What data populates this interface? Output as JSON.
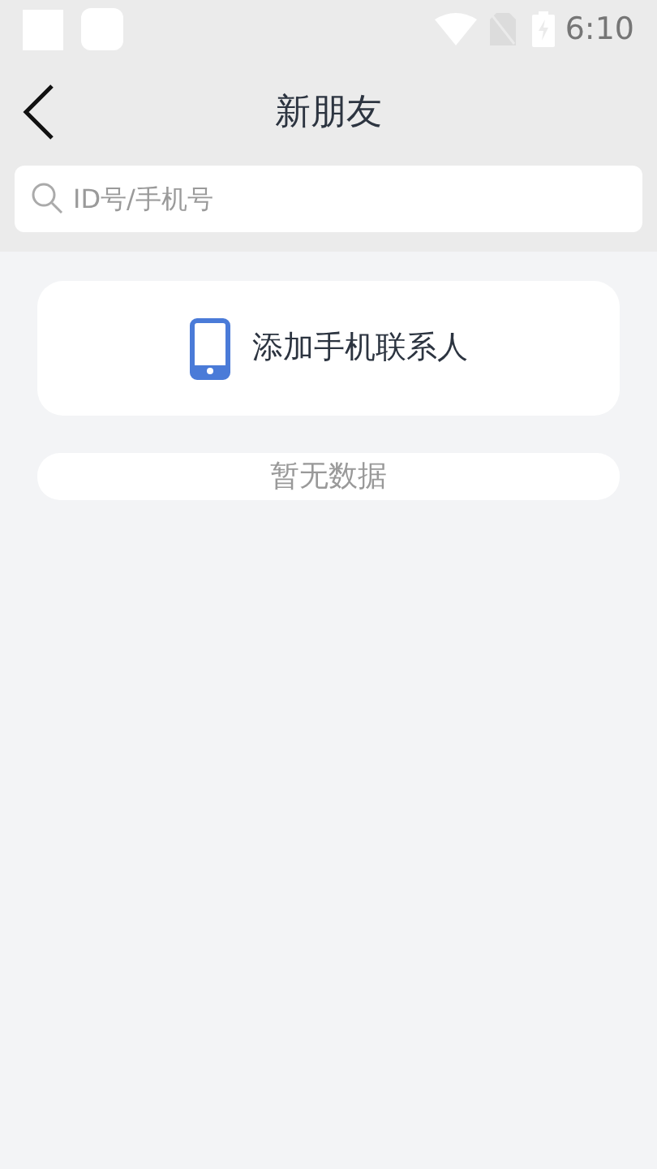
{
  "status_bar": {
    "time": "6:10"
  },
  "header": {
    "title": "新朋友"
  },
  "search": {
    "placeholder": "ID号/手机号"
  },
  "add_contacts": {
    "label": "添加手机联系人"
  },
  "empty_state": {
    "text": "暂无数据"
  }
}
